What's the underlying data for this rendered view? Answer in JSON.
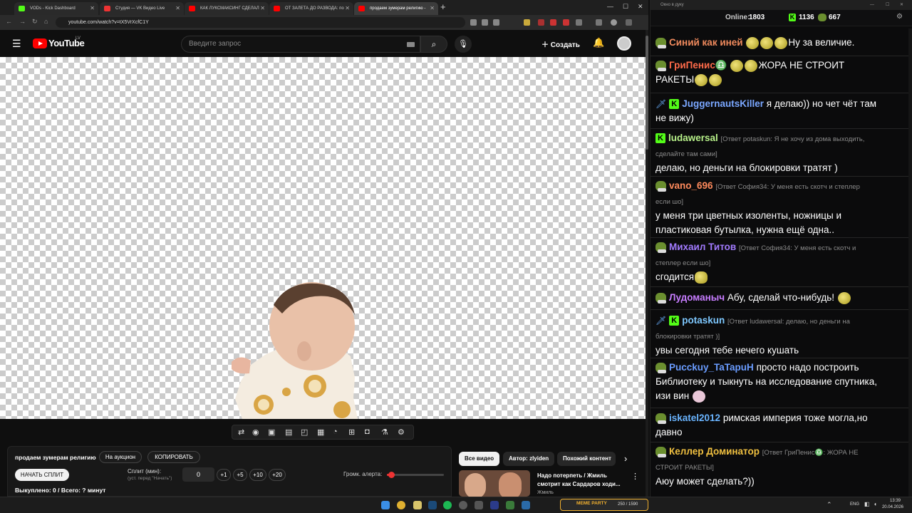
{
  "browser": {
    "tabs": [
      {
        "title": "VODs - Kick Dashboard",
        "favcolor": "#53fc18"
      },
      {
        "title": "Студия — VK Видео Live",
        "favcolor": "#e33"
      },
      {
        "title": "КАК ЛУКСМАКСИНГ СДЕЛАЛ",
        "favcolor": "#f00"
      },
      {
        "title": "ОТ ЗАЛЕТА ДО РАЗВОДА: по",
        "favcolor": "#f00"
      },
      {
        "title": "продаем зумерам религию -",
        "favcolor": "#f00"
      }
    ],
    "url": "youtube.com/watch?v=tX5VrXcfC1Y"
  },
  "youtube": {
    "logo": "YouTube",
    "region": "LV",
    "search_placeholder": "Введите запрос",
    "create_label": "Создать"
  },
  "panel": {
    "title": "продаем зумерам религию",
    "auction_label": "На аукцион",
    "copy_label": "КОПИРОВАТЬ",
    "start_split_label": "НАЧАТЬ СПЛИТ",
    "split_label": "Сплит (мин):",
    "split_hint": "(уст. перед \"Начать\")",
    "split_value": "0",
    "increments": [
      "+1",
      "+5",
      "+10",
      "+20"
    ],
    "volume_label": "Громк. алерта:",
    "volume_level": 0.08,
    "status": "Выкуплено: 0 / Всего: ? минут"
  },
  "recommendations": {
    "chips": [
      "Все видео",
      "Автор: zlyiden",
      "Похожий контент"
    ],
    "video": {
      "title": "Надо потерпеть / Жмиль смотрит как Сардаров ходи...",
      "channel": "Жмиль"
    }
  },
  "chat": {
    "window_title": "Окно в дуку",
    "online_label": "Online:",
    "online_count": "1803",
    "kick_count": "1136",
    "other_count": "667",
    "messages": [
      {
        "user": "Синий как иней",
        "color": "#f08a5d",
        "text": "Ну за величие."
      },
      {
        "user": "ГриПенис♎",
        "color": "#ff6b4a",
        "text": "ЖОРА НЕ СТРОИТ",
        "text2": "РАКЕТЫ"
      },
      {
        "user": "JuggernautsKiller",
        "color": "#7aa7ff",
        "text": "я делаю)) но чет чёт там",
        "text2": "не вижу)"
      },
      {
        "user": "ludawersal",
        "color": "#b8f28a",
        "reply": "[Ответ potaskun: Я не хочу из дома выходить,",
        "reply2": "сделайте там сами]",
        "text": "делаю, но деньги на блокировки тратят )"
      },
      {
        "user": "vano_696",
        "color": "#ff8a5c",
        "reply": "[Ответ София34: У меня есть скотч и степлер",
        "reply2": "если шо]",
        "text": "у меня три цветных изоленты, ножницы и",
        "text2": "пластиковая бутылка, нужна ещё одна.."
      },
      {
        "user": "Михаил Титов",
        "color": "#a27bff",
        "reply": "[Ответ София34: У меня есть скотч и",
        "reply2": "степлер если шо]",
        "text": "сгодится"
      },
      {
        "user": "Лудоманыч",
        "color": "#c77dff",
        "text": "Абу, сделай что-нибудь!"
      },
      {
        "user": "potaskun",
        "color": "#7ec8ff",
        "reply": "[Ответ ludawersal: делаю, но деньги на",
        "reply2": "блокировки тратят )]",
        "text": "увы сегодня тебе нечего кушать"
      },
      {
        "user": "Pucckuy_TaTapuH",
        "color": "#6a9cff",
        "text": "просто надо построить",
        "text2": "Библиотеку и  тыкнуть на исследование спутника,",
        "text3": "изи вин"
      },
      {
        "user": "iskatel2012",
        "color": "#6ab4ff",
        "text": "римская империя тоже могла,но",
        "text2": "давно"
      },
      {
        "user": "Келлер Доминатор",
        "color": "#f0c040",
        "reply": "[Ответ ГриПенис♎: ЖОРА НЕ",
        "reply2": "СТРОИТ РАКЕТЫ]",
        "text": "Аюу может сделать?))"
      }
    ]
  },
  "taskbar": {
    "lang": "ENG",
    "time": "13:39",
    "date": "20.04.2026",
    "widget": "MEME PARTY",
    "widget_counter": "250 / 1590"
  }
}
